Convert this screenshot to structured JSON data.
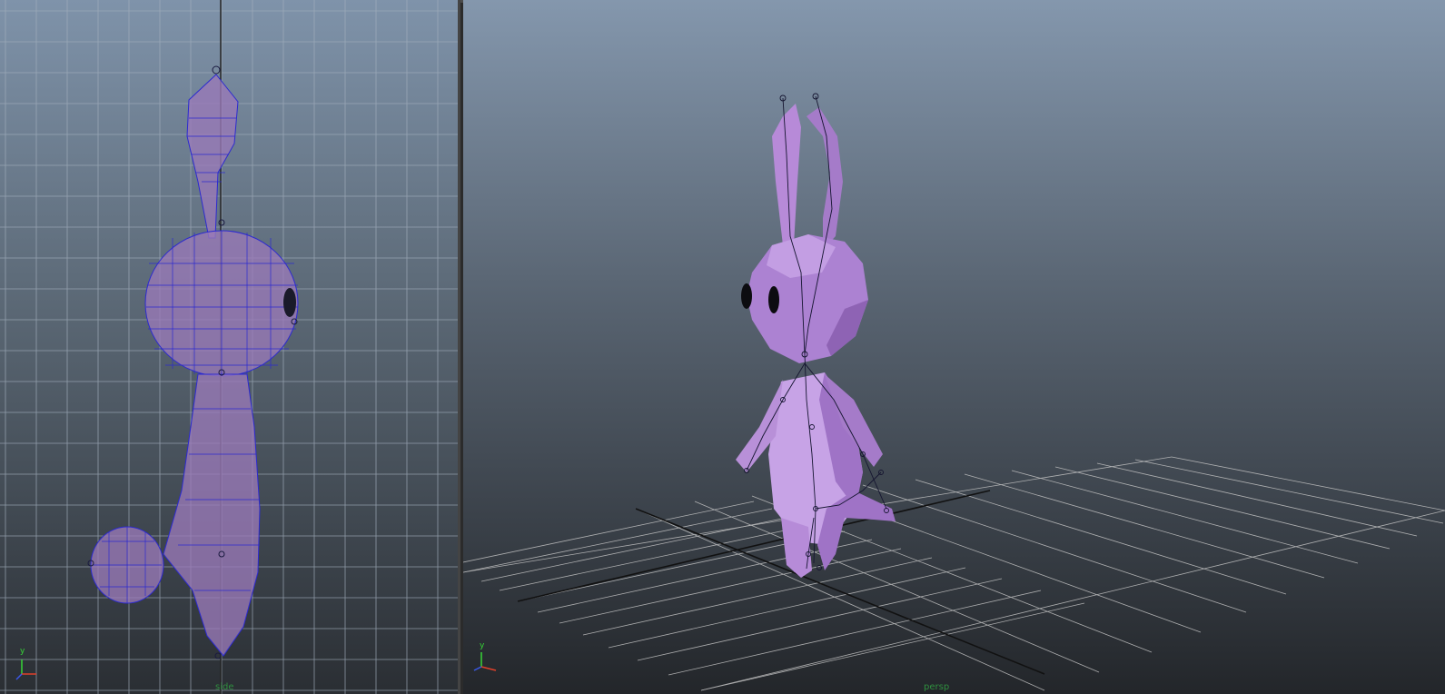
{
  "viewports": {
    "side": {
      "camera": "side",
      "axis_label": "y"
    },
    "persp": {
      "camera": "persp",
      "axis_label": "y"
    }
  },
  "colors": {
    "mesh": "#b68bd8",
    "mesh_dark": "#8a5cb0",
    "wire": "#2c2ad0",
    "grid_side": "#9aa6b4",
    "grid_persp": "#b9b9b9",
    "axis_x": "#e0402a",
    "axis_y": "#37d637",
    "axis_z": "#3a58e8"
  },
  "icons": [
    "axis-gizmo-icon"
  ]
}
